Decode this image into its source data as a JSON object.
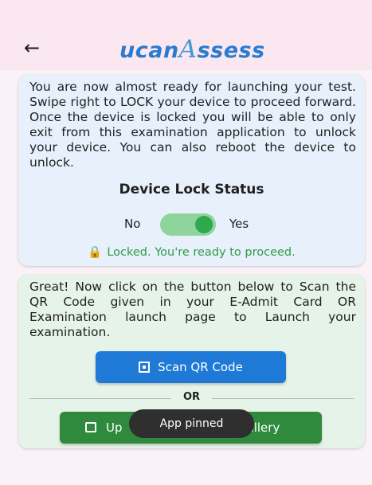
{
  "header": {
    "back_icon": "←",
    "logo_part1": "ucan",
    "logo_part2": "A",
    "logo_part3": "ssess",
    "colors": {
      "app_bar": "#fbe7ef",
      "logo": "#2b7bd0"
    }
  },
  "lock_card": {
    "paragraph": "You are now almost ready for launching your test. Swipe right to LOCK your device to proceed forward. Once the device is locked you will be able to only exit from this examination application to unlock your device. You can also reboot the device to unlock.",
    "title": "Device Lock Status",
    "toggle": {
      "off_label": "No",
      "on_label": "Yes",
      "state": "on"
    },
    "status_icon": "🔒",
    "status_text": "Locked. You're ready to proceed.",
    "colors": {
      "background": "#e8f1fb",
      "status": "#2e9a4a"
    }
  },
  "scan_card": {
    "paragraph": "Great! Now click on the button below to Scan the QR Code given in your E-Admit Card OR Examination launch page to Launch your examination.",
    "scan_button_label": "Scan QR Code",
    "scan_icon": "qr-code-icon",
    "or_label": "OR",
    "gallery_button_label": "Up",
    "gallery_button_label_tail": "allery",
    "gallery_icon": "image-upload-icon",
    "colors": {
      "background": "#e6f3e8",
      "scan_button": "#1e7ad6",
      "gallery_button": "#2f8a3e"
    }
  },
  "toast": {
    "text": "App pinned"
  }
}
